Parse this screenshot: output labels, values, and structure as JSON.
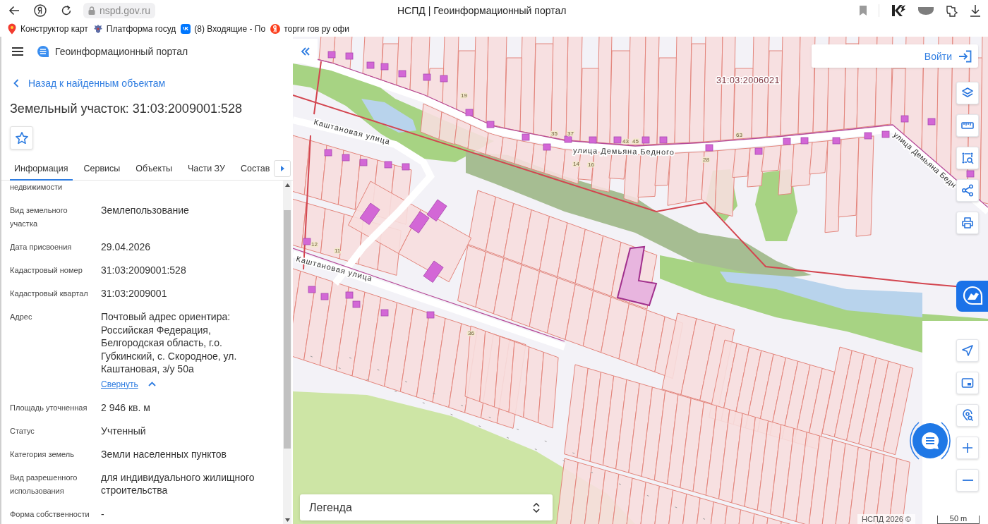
{
  "browser": {
    "address": "nspd.gov.ru",
    "title": "НСПД | Геоинформационный портал",
    "bookmarks": [
      {
        "kind": "pin",
        "label": "Конструктор карт"
      },
      {
        "kind": "emblem",
        "label": "Платформа госуд"
      },
      {
        "kind": "vk",
        "label": "(8) Входящие - По"
      },
      {
        "kind": "yandex",
        "label": "торги гов ру офи"
      }
    ]
  },
  "sidebar": {
    "header_title": "Геоинформационный портал",
    "back_link": "Назад к найденным объектам",
    "title": "Земельный участок: 31:03:2009001:528",
    "starred": false,
    "tabs": [
      {
        "label": "Информация",
        "selected": true
      },
      {
        "label": "Сервисы",
        "selected": false
      },
      {
        "label": "Объекты",
        "selected": false
      },
      {
        "label": "Части ЗУ",
        "selected": false
      },
      {
        "label": "Состав",
        "selected": false
      }
    ],
    "fields": [
      {
        "label": "недвижимости"
      },
      {
        "label": "Вид земельного участка",
        "value": "Землепользование"
      },
      {
        "label": "Дата присвоения",
        "value": "29.04.2026"
      },
      {
        "label": "Кадастровый номер",
        "value": "31:03:2009001:528"
      },
      {
        "label": "Кадастровый квартал",
        "value": "31:03:2009001"
      },
      {
        "label": "Адрес",
        "value": "Почтовый адрес ориентира: Российская Федерация, Белгородская область, г.о. Губкинский, с. Скородное, ул. Каштановая, з/у 50а",
        "toggle": {
          "label": "Свернуть",
          "expanded": true
        }
      },
      {
        "label": "Площадь уточненная",
        "value": "2 946 кв. м"
      },
      {
        "label": "Статус",
        "value": "Учтенный"
      },
      {
        "label": "Категория земель",
        "value": "Земли населенных пунктов"
      },
      {
        "label": "Вид разрешенного использования",
        "value": "для индивидуального жилищного строительства"
      },
      {
        "label": "Форма собственности",
        "value": "-"
      }
    ]
  },
  "map": {
    "login": "Войти",
    "quarter_label": "31:03:2006021",
    "street_labels": [
      "Каштановая улица",
      "Каштановая улица",
      "улица Демьяна Бедного",
      "улица Демьяна Бедн"
    ],
    "house_numbers": [
      "19",
      "35",
      "37",
      "43",
      "45",
      "14",
      "16",
      "12",
      "11",
      "36",
      "28",
      "63"
    ],
    "legend": "Легенда",
    "attribution": "НСПД 2026 ©",
    "scale": "50 m"
  }
}
